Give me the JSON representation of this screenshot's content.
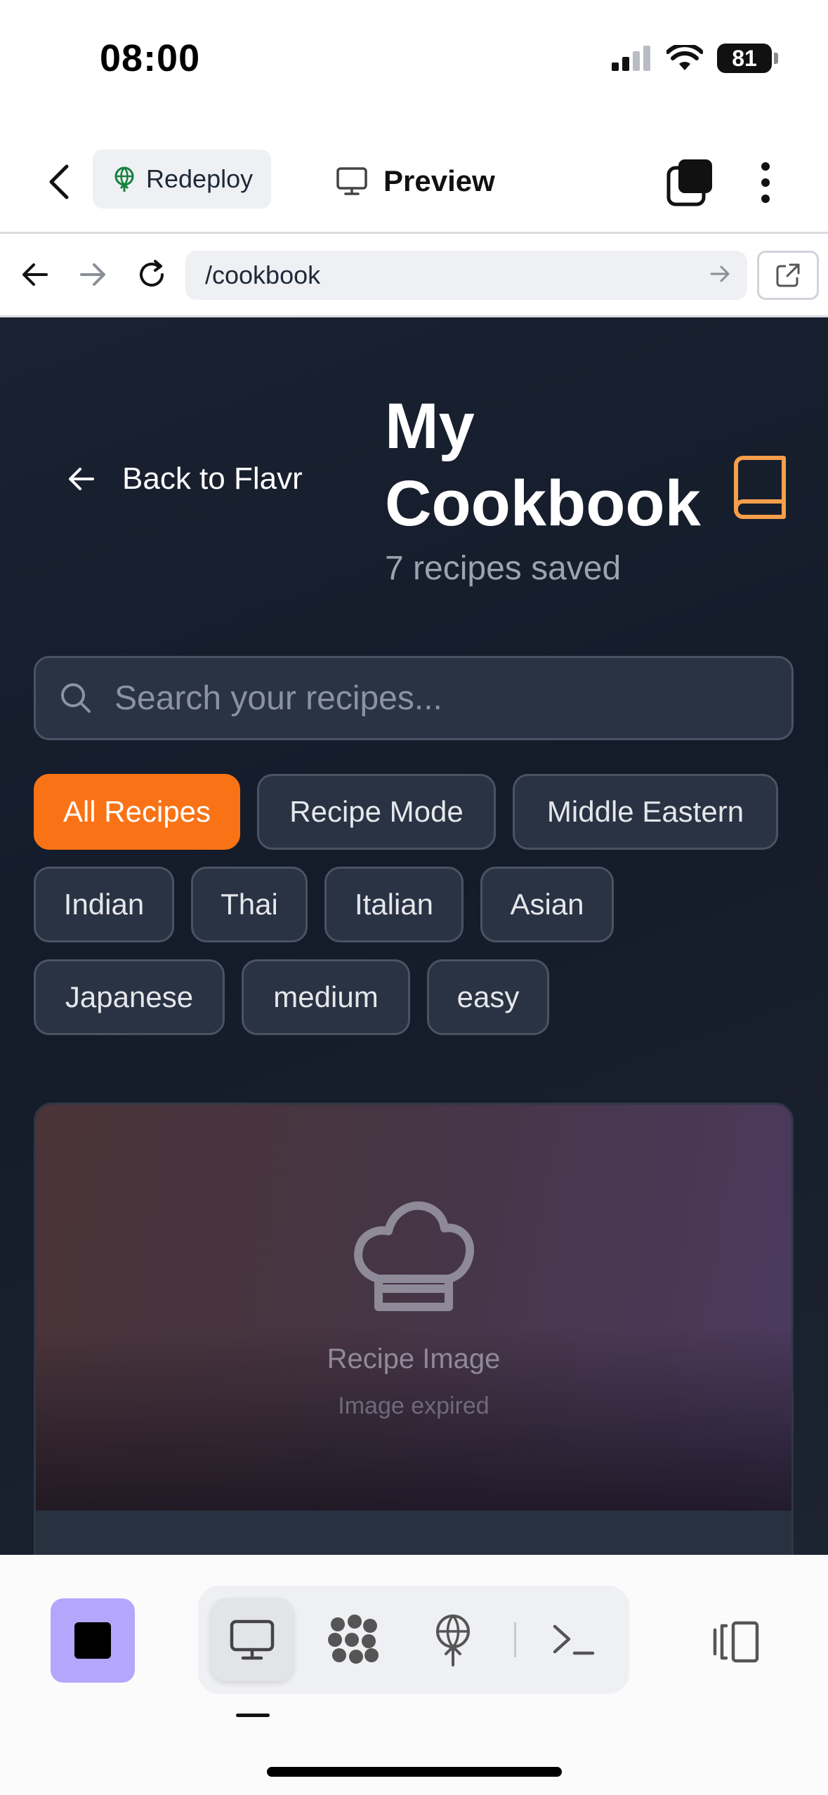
{
  "status_bar": {
    "time": "08:00",
    "battery": "81"
  },
  "app_header": {
    "redeploy_label": "Redeploy",
    "preview_label": "Preview"
  },
  "browser": {
    "url": "/cookbook"
  },
  "page": {
    "back_label": "Back to Flavr",
    "title": "My Cookbook",
    "subtitle": "7 recipes saved",
    "search_placeholder": "Search your recipes...",
    "filters": [
      {
        "label": "All Recipes",
        "active": true
      },
      {
        "label": "Recipe Mode",
        "active": false
      },
      {
        "label": "Middle Eastern",
        "active": false
      },
      {
        "label": "Indian",
        "active": false
      },
      {
        "label": "Thai",
        "active": false
      },
      {
        "label": "Italian",
        "active": false
      },
      {
        "label": "Asian",
        "active": false
      },
      {
        "label": "Japanese",
        "active": false
      },
      {
        "label": "medium",
        "active": false
      },
      {
        "label": "easy",
        "active": false
      }
    ],
    "card": {
      "image_label": "Recipe Image",
      "image_status": "Image expired"
    }
  },
  "colors": {
    "accent": "#f97316",
    "background": "#141b29",
    "book_icon": "#f59e4b",
    "stop_button": "#b4a7fb"
  },
  "icons": {
    "app_header": [
      "back-chevron-icon",
      "globe-icon",
      "monitor-icon",
      "layers-icon",
      "more-vertical-icon"
    ],
    "browser": [
      "arrow-left-icon",
      "arrow-right-icon",
      "reload-icon",
      "arrow-right-icon",
      "external-link-icon"
    ],
    "page": [
      "arrow-left-icon",
      "book-icon",
      "search-icon",
      "chef-hat-icon"
    ],
    "bottom_bar": [
      "stop-icon",
      "monitor-icon",
      "grid-dots-icon",
      "globe-icon",
      "terminal-icon",
      "panel-toggle-icon"
    ]
  }
}
